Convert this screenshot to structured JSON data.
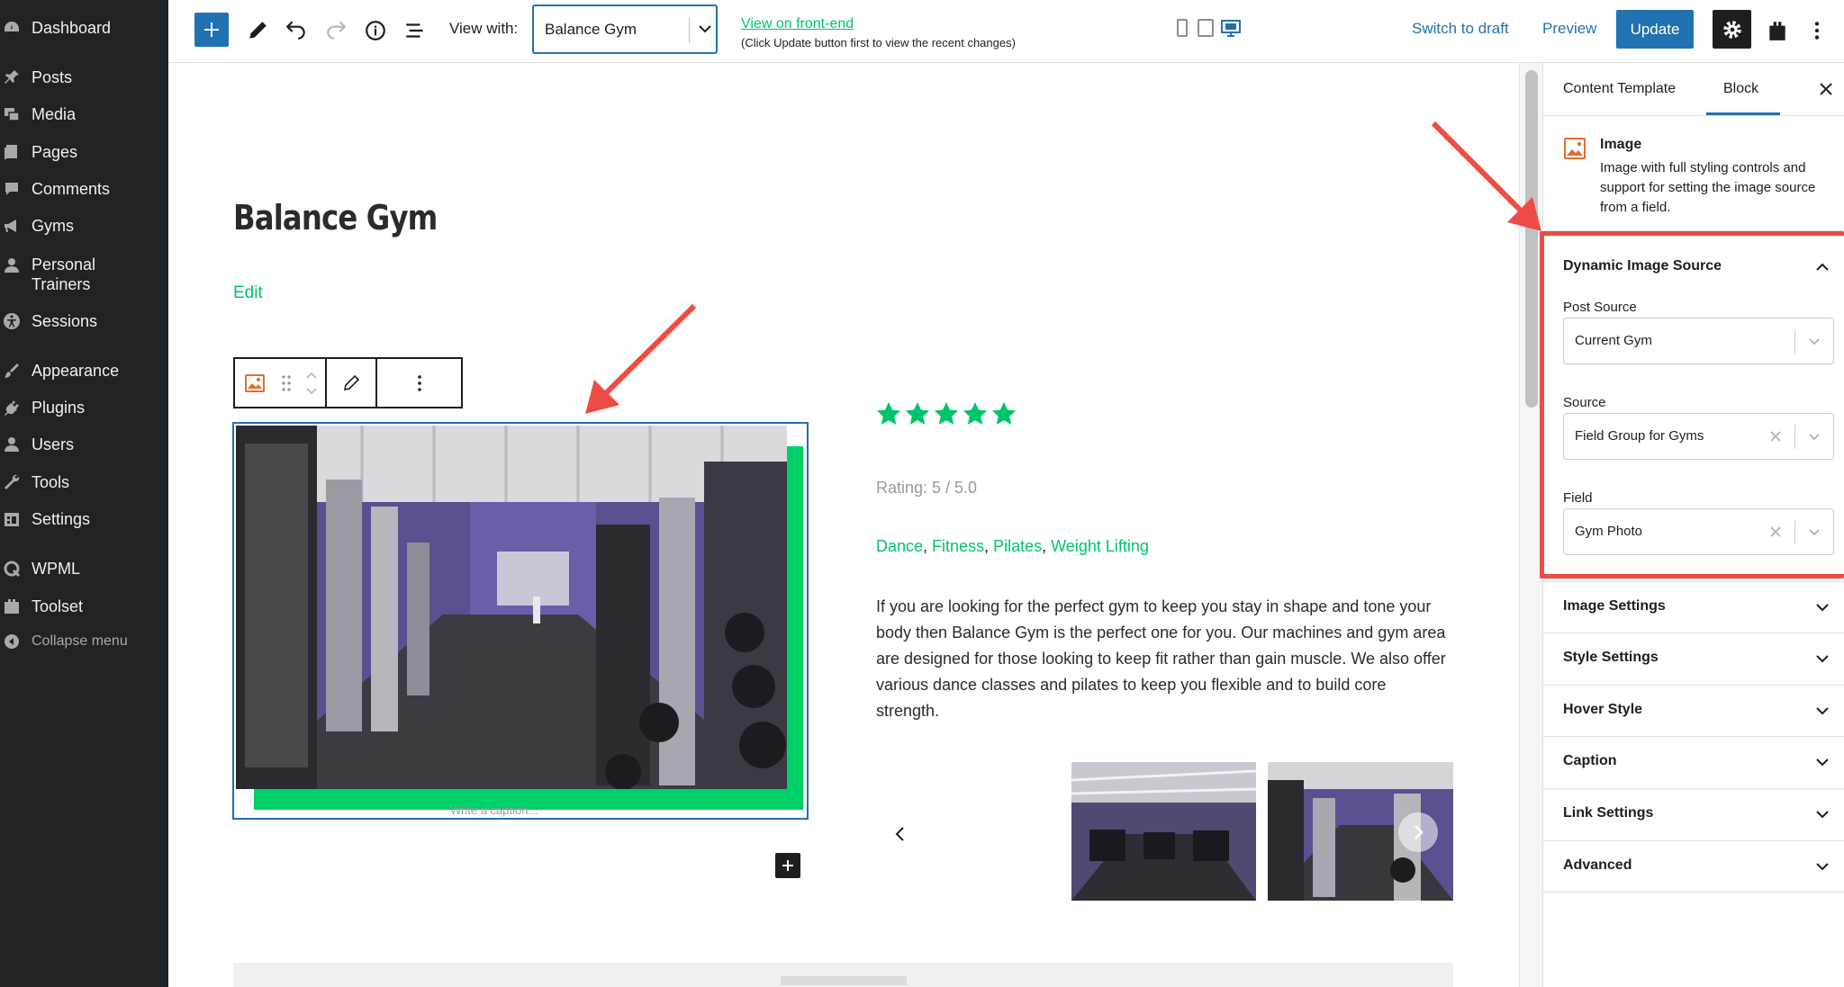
{
  "admin_menu": {
    "items": [
      {
        "label": "Dashboard",
        "icon": "dashboard-icon"
      },
      {
        "label": "Posts",
        "icon": "pin-icon"
      },
      {
        "label": "Media",
        "icon": "media-icon"
      },
      {
        "label": "Pages",
        "icon": "pages-icon"
      },
      {
        "label": "Comments",
        "icon": "comment-icon"
      },
      {
        "label": "Gyms",
        "icon": "megaphone-icon"
      },
      {
        "label": "Personal\nTrainers",
        "icon": "user-icon"
      },
      {
        "label": "Sessions",
        "icon": "universal-access-icon"
      },
      {
        "label": "Appearance",
        "icon": "brush-icon"
      },
      {
        "label": "Plugins",
        "icon": "plug-icon"
      },
      {
        "label": "Users",
        "icon": "user-icon"
      },
      {
        "label": "Tools",
        "icon": "wrench-icon"
      },
      {
        "label": "Settings",
        "icon": "settings-icon"
      },
      {
        "label": "WPML",
        "icon": "wpml-icon"
      },
      {
        "label": "Toolset",
        "icon": "toolset-icon"
      }
    ],
    "collapse_label": "Collapse menu"
  },
  "toolbar": {
    "view_with_label": "View with:",
    "view_with_value": "Balance Gym",
    "front_end_link": "View on front-end",
    "front_end_note": "(Click Update button first to view the recent changes)",
    "switch_to_draft": "Switch to draft",
    "preview": "Preview",
    "update": "Update"
  },
  "editor": {
    "post_title": "Balance Gym",
    "edit_link": "Edit",
    "caption_placeholder": "Write a caption...",
    "rating_text": "Rating: 5 / 5.0",
    "rating_value": 5,
    "categories": [
      "Dance",
      "Fitness",
      "Pilates",
      "Weight Lifting"
    ],
    "description": "If you are looking for the perfect gym to keep you stay in shape and tone your body then Balance Gym is the perfect one for you. Our machines and gym area are designed for those looking to keep fit rather than gain muscle. We also offer various dance classes and pilates to keep you flexible and to build core strength."
  },
  "sidebar": {
    "tabs": [
      "Content Template",
      "Block"
    ],
    "active_tab": "Block",
    "block_card": {
      "title": "Image",
      "description": "Image with full styling controls and support for setting the image source from a field."
    },
    "dynamic_panel": {
      "title": "Dynamic Image Source",
      "post_source_label": "Post Source",
      "post_source_value": "Current Gym",
      "source_label": "Source",
      "source_value": "Field Group for Gyms",
      "field_label": "Field",
      "field_value": "Gym Photo"
    },
    "panels": [
      "Image Settings",
      "Style Settings",
      "Hover Style",
      "Caption",
      "Link Settings",
      "Advanced"
    ]
  },
  "colors": {
    "admin_bg": "#1d2327",
    "accent_blue": "#2271b1",
    "brand_green": "#00c46a",
    "annotation_red": "#ef4b45"
  }
}
